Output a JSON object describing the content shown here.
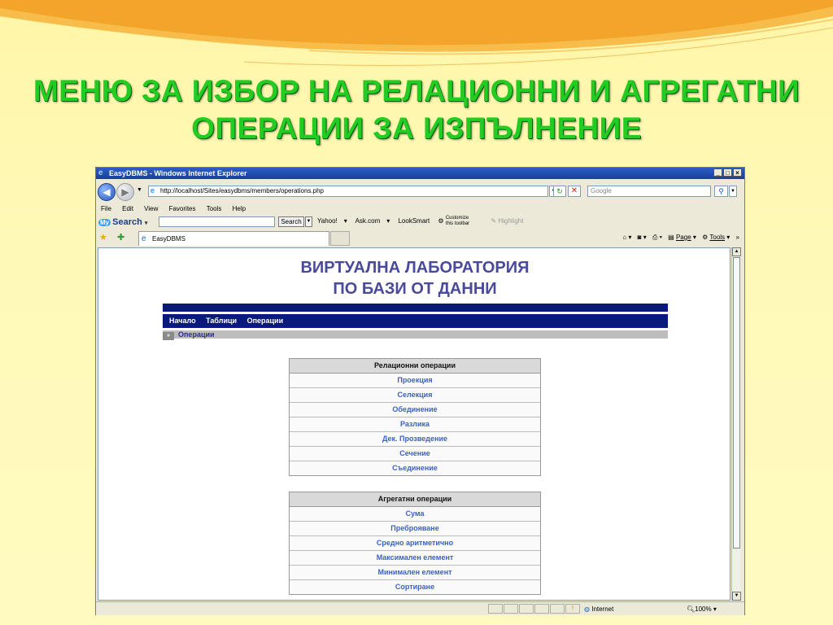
{
  "slide": {
    "title_line1": "МЕНЮ ЗА ИЗБОР НА РЕЛАЦИОННИ И АГРЕГАТНИ",
    "title_line2": "ОПЕРАЦИИ ЗА ИЗПЪЛНЕНИЕ"
  },
  "browser": {
    "window_title": "EasyDBMS - Windows Internet Explorer",
    "address": "http://localhost/Sites/easydbms/members/operations.php",
    "search_box_placeholder": "Google",
    "menu": [
      "File",
      "Edit",
      "View",
      "Favorites",
      "Tools",
      "Help"
    ],
    "mysearch_label": "Search",
    "mysearch_my": "My",
    "search_button": "Search",
    "toolbar_links": [
      "Yahoo!",
      "Ask.com",
      "LookSmart"
    ],
    "customize_label_1": "Customize",
    "customize_label_2": "this toolbar",
    "highlight_label": "Highlight",
    "tab_title": "EasyDBMS",
    "tools_page": "Page",
    "tools_tools": "Tools",
    "status_zone": "Internet",
    "status_zoom": "100%"
  },
  "site": {
    "title_line1": "ВИРТУАЛНА ЛАБОРАТОРИЯ",
    "title_line2": "ПО БАЗИ ОТ ДАННИ",
    "nav": [
      "Начало",
      "Таблици",
      "Операции"
    ],
    "breadcrumb": "Операции",
    "relational": {
      "header": "Релационни операции",
      "items": [
        "Проекция",
        "Селекция",
        "Обединение",
        "Разлика",
        "Дек. Прозведение",
        "Сечение",
        "Съединение"
      ]
    },
    "aggregate": {
      "header": "Агрегатни операции",
      "items": [
        "Сума",
        "Преброяване",
        "Средно аритметично",
        "Максимален елемент",
        "Минимален елемент",
        "Сортиране"
      ]
    }
  }
}
